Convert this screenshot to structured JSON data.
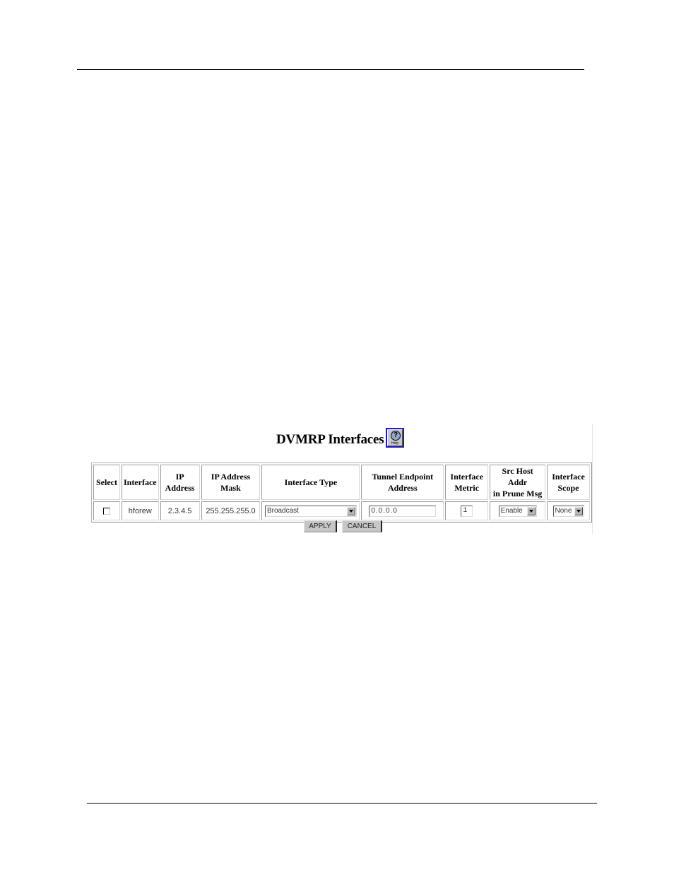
{
  "page": {
    "title": "DVMRP Interfaces",
    "help_button": {
      "icon": "question-mark-icon",
      "label": "Help"
    }
  },
  "table": {
    "columns": [
      {
        "label_line1": "Select",
        "label_line2": ""
      },
      {
        "label_line1": "Interface",
        "label_line2": ""
      },
      {
        "label_line1": "IP",
        "label_line2": "Address"
      },
      {
        "label_line1": "IP Address",
        "label_line2": "Mask"
      },
      {
        "label_line1": "Interface Type",
        "label_line2": ""
      },
      {
        "label_line1": "Tunnel Endpoint",
        "label_line2": "Address"
      },
      {
        "label_line1": "Interface",
        "label_line2": "Metric"
      },
      {
        "label_line1": "Src Host Addr",
        "label_line2": "in Prune Msg"
      },
      {
        "label_line1": "Interface",
        "label_line2": "Scope"
      }
    ],
    "rows": [
      {
        "selected": false,
        "interface": "hforew",
        "ip_address": "2.3.4.5",
        "ip_address_mask": "255.255.255.0",
        "interface_type": "Broadcast",
        "tunnel_endpoint_address": "0.0.0.0",
        "interface_metric": "1",
        "src_host_addr_in_prune_msg": "Enable",
        "interface_scope": "None"
      }
    ]
  },
  "buttons": {
    "apply": "APPLY",
    "cancel": "CANCEL"
  }
}
